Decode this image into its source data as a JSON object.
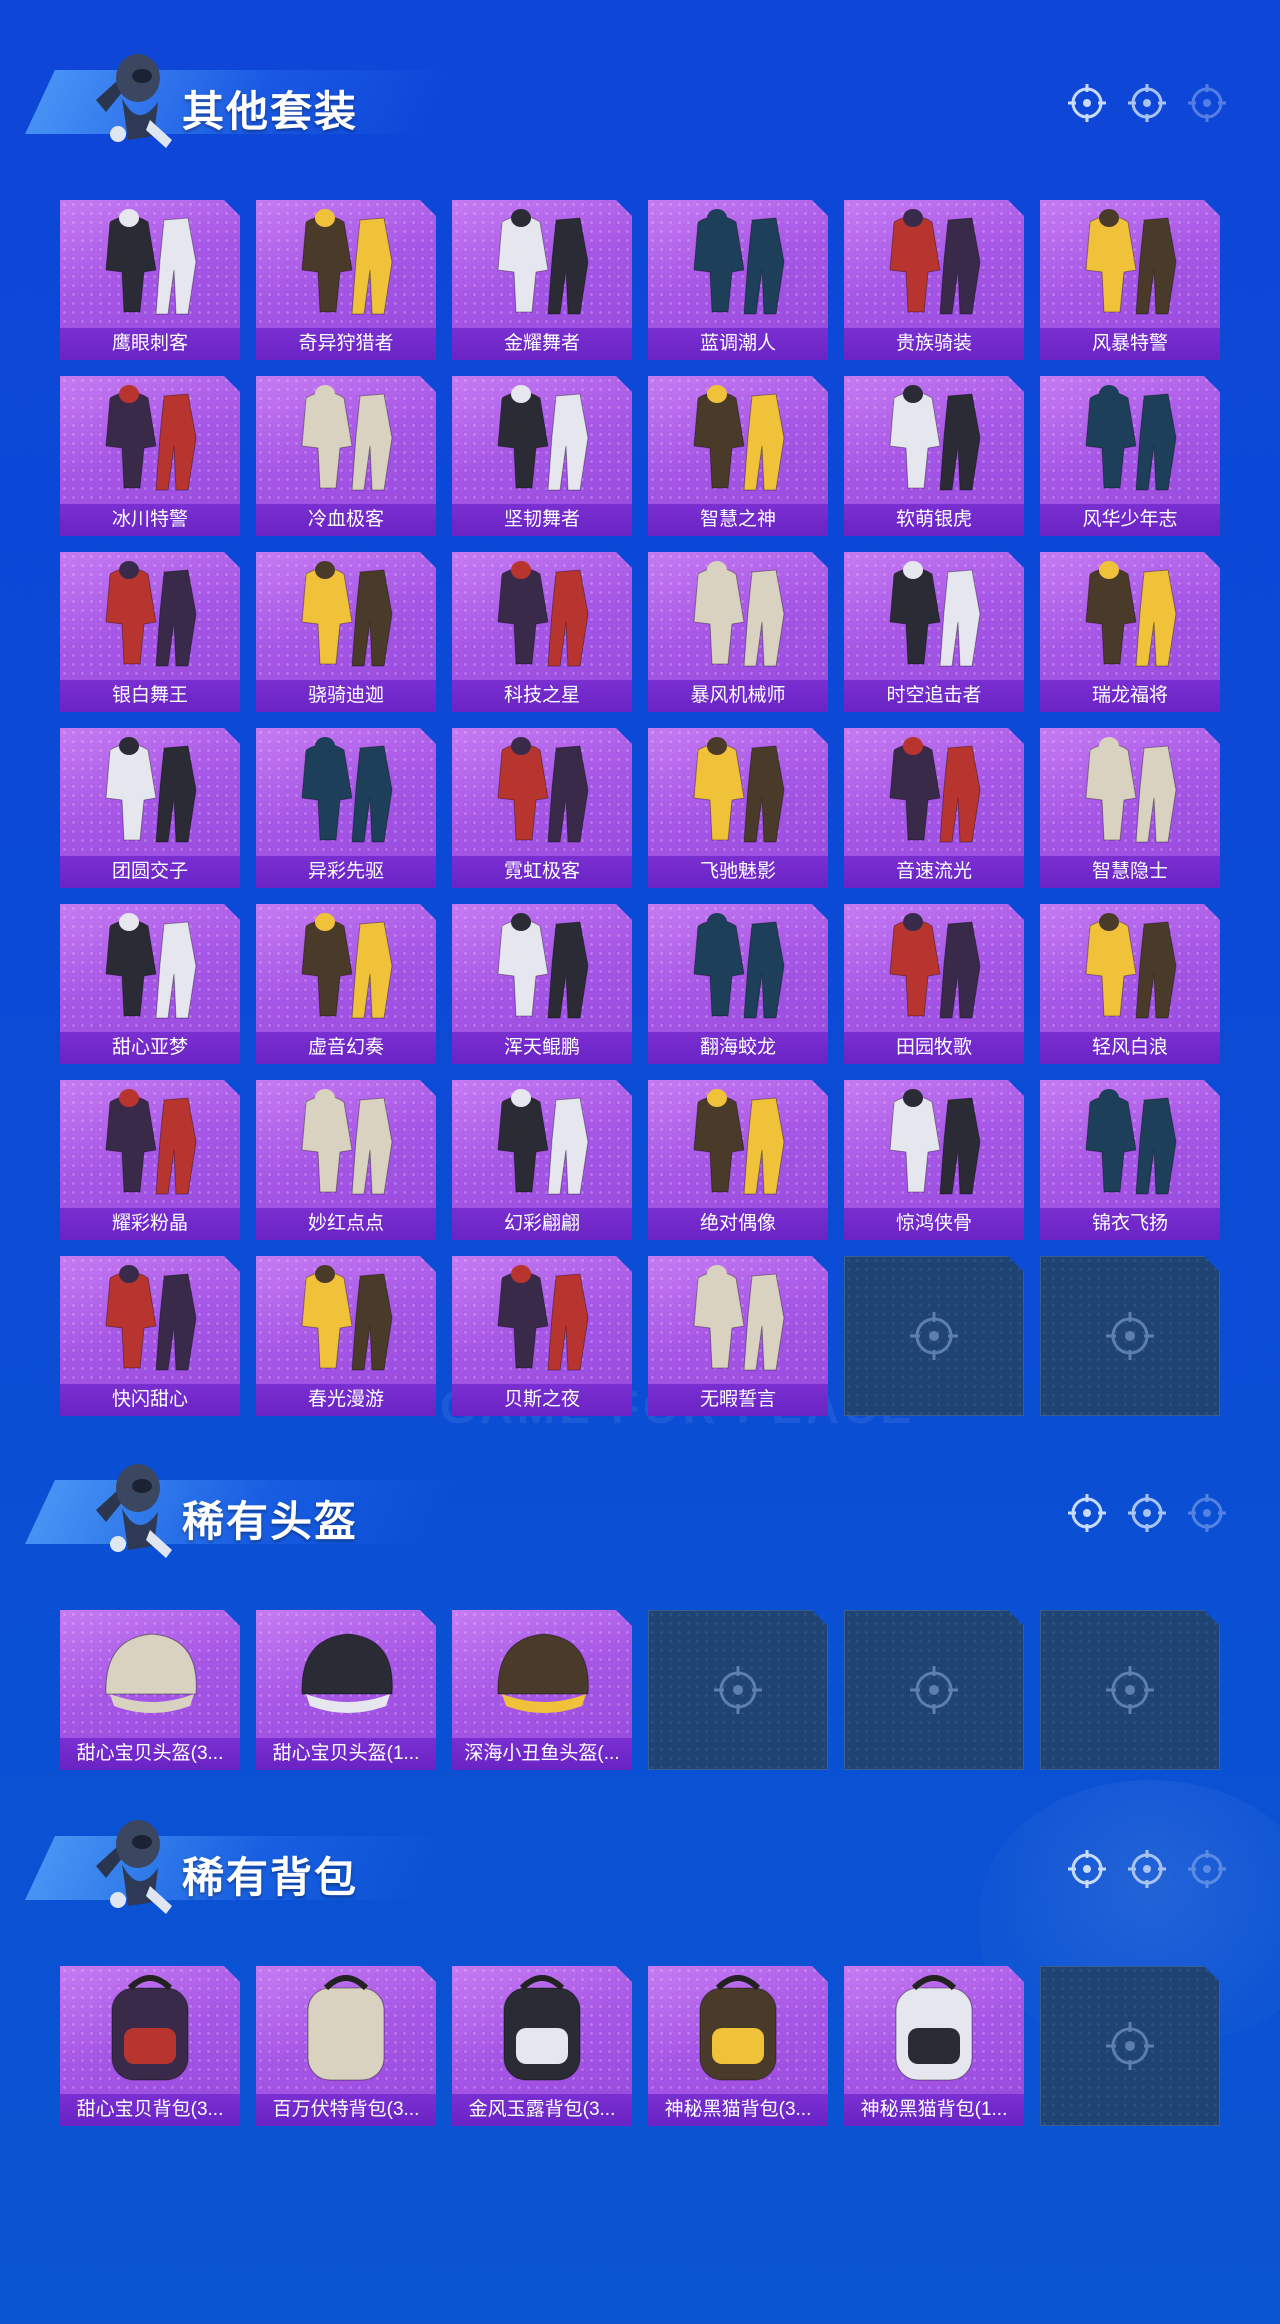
{
  "sections": [
    {
      "title": "其他套装",
      "items": [
        "鹰眼刺客",
        "奇异狩猎者",
        "金耀舞者",
        "蓝调潮人",
        "贵族骑装",
        "风暴特警",
        "冰川特警",
        "冷血极客",
        "坚韧舞者",
        "智慧之神",
        "软萌银虎",
        "风华少年志",
        "银白舞王",
        "骁骑迪迦",
        "科技之星",
        "暴风机械师",
        "时空追击者",
        "瑞龙福将",
        "团圆交子",
        "异彩先驱",
        "霓虹极客",
        "飞驰魅影",
        "音速流光",
        "智慧隐士",
        "甜心亚梦",
        "虚音幻奏",
        "浑天鲲鹏",
        "翻海蛟龙",
        "田园牧歌",
        "轻风白浪",
        "耀彩粉晶",
        "妙红点点",
        "幻彩翩翩",
        "绝对偶像",
        "惊鸿侠骨",
        "锦衣飞扬",
        "快闪甜心",
        "春光漫游",
        "贝斯之夜",
        "无暇誓言"
      ],
      "empty_slots": 2
    },
    {
      "title": "稀有头盔",
      "items": [
        "甜心宝贝头盔(3...",
        "甜心宝贝头盔(1...",
        "深海小丑鱼头盔(..."
      ],
      "empty_slots": 3
    },
    {
      "title": "稀有背包",
      "items": [
        "甜心宝贝背包(3...",
        "百万伏特背包(3...",
        "金风玉露背包(3...",
        "神秘黑猫背包(3...",
        "神秘黑猫背包(1..."
      ],
      "empty_slots": 1
    }
  ],
  "watermark": "GAME FOR PEACE",
  "colors": {
    "background": "#0e46d8",
    "tile": "#a757e6",
    "label_bar": "#6a23c4",
    "empty_tile": "#1f4474"
  },
  "icons": {
    "header_right": "crosshair-icon",
    "empty_slot": "crosshair-icon",
    "header_left": "mascot-icon"
  }
}
